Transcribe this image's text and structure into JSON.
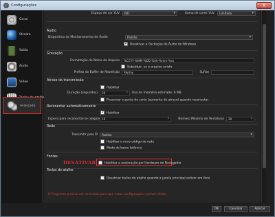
{
  "window": {
    "title": "Configurações",
    "close_label": "X"
  },
  "sidebar": {
    "items": [
      {
        "label": "Geral",
        "icon": "gear-icon"
      },
      {
        "label": "Stream",
        "icon": "globe-icon"
      },
      {
        "label": "Saída",
        "icon": "film-icon"
      },
      {
        "label": "Áudio",
        "icon": "speaker-icon"
      },
      {
        "label": "Vídeo",
        "icon": "monitor-icon"
      },
      {
        "label": "Teclas de atalho",
        "icon": "keyboard-icon"
      },
      {
        "label": "Avançado",
        "icon": "gears-icon"
      }
    ],
    "active_index": 6
  },
  "video": {
    "color_space_label": "Espaço de cor YUV",
    "color_space_value": "601",
    "color_range_label": "Gama de cores YUV",
    "color_range_value": "Limitado"
  },
  "audio": {
    "section": "Áudio",
    "monitor_device_label": "Dispositivo de Monitoramento de Áudio",
    "monitor_device_value": "Padrão",
    "disable_ducking_label": "Desativar a Oscilação de Áudio do Windows",
    "disable_ducking_checked": true
  },
  "recording": {
    "section": "Gravação",
    "filename_format_label": "Formatação de Nome de Arquivo",
    "filename_format_value": "%CCYY-%MM-%DD %hh-%mm-%ss",
    "overwrite_label": "Substituir, se o arquivo existir",
    "overwrite_checked": false,
    "replay_prefix_label": "Prefixo do Buffer de Repetição",
    "replay_prefix_value": "Replay",
    "suffix_label": "Sufixo",
    "suffix_value": ""
  },
  "stream_delay": {
    "section": "Atraso da transmissão",
    "enable_label": "Habilitar",
    "enable_checked": false,
    "duration_label": "Duração (segundos)",
    "duration_value": "20",
    "memory_usage": "Uso de memória estimado: 6 MB",
    "preserve_label": "Preservar o ponto de corte (aumento de atraso) quando reconectar",
    "preserve_checked": true
  },
  "reconnect": {
    "section": "Reconectar automaticamente",
    "enable_label": "Habilitar",
    "enable_checked": true,
    "retry_delay_label": "Espera para reconectar-se (segundos)",
    "retry_delay_value": "10",
    "max_retries_label": "Número Máximo de Tentativas",
    "max_retries_value": "20"
  },
  "network": {
    "section": "Rede",
    "bind_ip_label": "Transmitir pelo IP",
    "bind_ip_value": "Padrão",
    "new_code_label": "Habilitar o novo código de rede",
    "new_code_checked": false,
    "low_latency_label": "Modo de baixa latência",
    "low_latency_checked": false
  },
  "sources": {
    "section": "Fontes",
    "annotation": "DESATIVAR",
    "hw_accel_label": "Habilitar a aceleração por Hardware do Navegador",
    "hw_accel_checked": false
  },
  "hotkeys": {
    "section": "Teclas de atalho",
    "disable_unfocused_label": "Desativar teclas de atalho quando a janela principal estiver em foco",
    "disable_unfocused_checked": false
  },
  "status": {
    "error": "O Programa precisa ser reiniciado para que estas configurações surtam efeito."
  },
  "buttons": {
    "ok": "OK",
    "cancel": "Cancelar",
    "apply": "Aplicar"
  },
  "colors": {
    "accent_red": "#e0302a",
    "background": "#262626"
  }
}
